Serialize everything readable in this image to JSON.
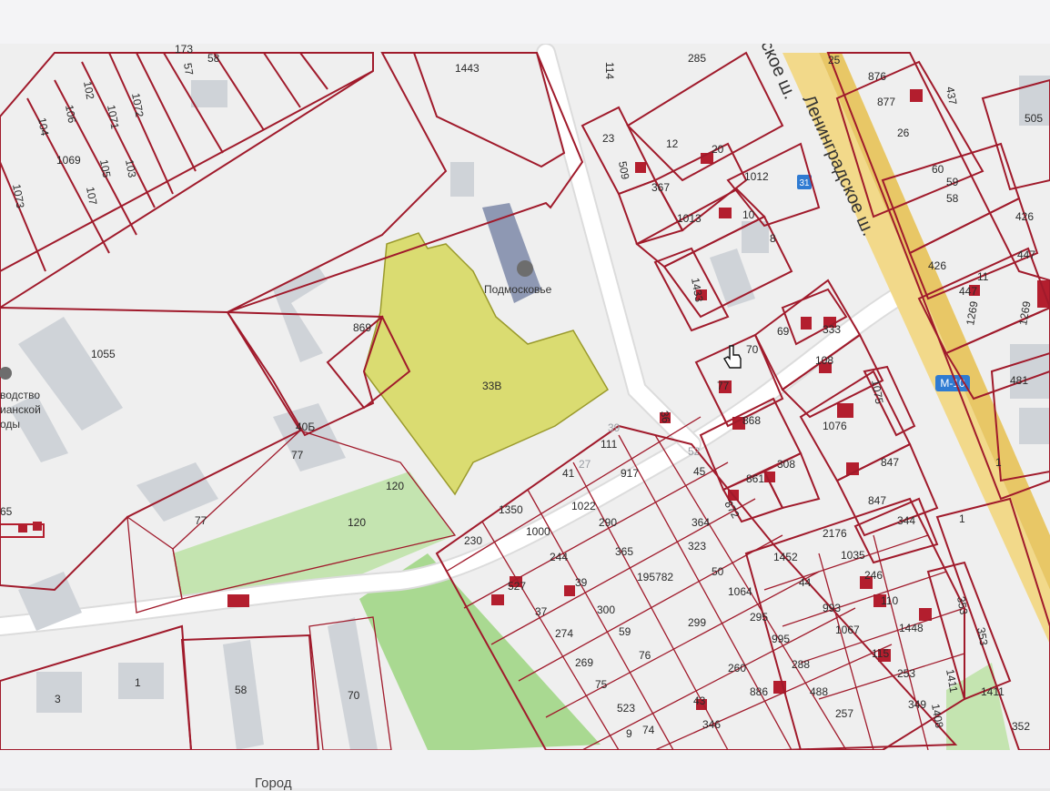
{
  "map": {
    "road_label": "M-10",
    "highway_sign": "31",
    "street_name_1": "Ленинградское ш.",
    "street_name_2": "ское ш.",
    "poi_name": "Подмосковье",
    "factory_label_1": "водство",
    "factory_label_2": "ианской",
    "factory_label_3": "оды",
    "highlighted_plot_id": "33В",
    "plot_ids_left": [
      "1443",
      "173",
      "58",
      "57",
      "102",
      "106",
      "1071",
      "1072",
      "104",
      "1069",
      "105",
      "103",
      "107",
      "1073",
      "1055",
      "869",
      "40Б",
      "77",
      "120",
      "77",
      "120",
      "65"
    ],
    "plot_ids_center": [
      "114",
      "285",
      "23",
      "12",
      "20",
      "509",
      "367",
      "1012",
      "1013",
      "10",
      "8",
      "1433",
      "69",
      "333",
      "70",
      "108",
      "77",
      "1075",
      "868",
      "1076",
      "36",
      "39",
      "111",
      "52",
      "45",
      "861",
      "308",
      "41",
      "27",
      "917",
      "872",
      "1350",
      "1022",
      "230",
      "1000",
      "290",
      "365",
      "364",
      "323",
      "244",
      "527",
      "39",
      "195782",
      "50",
      "37",
      "300",
      "1064",
      "299",
      "295",
      "274",
      "59",
      "269",
      "76",
      "995",
      "75",
      "260",
      "886",
      "288",
      "488",
      "523",
      "43",
      "9",
      "74",
      "346",
      "257"
    ],
    "plot_ids_right": [
      "25",
      "876",
      "877",
      "437",
      "505",
      "26",
      "60",
      "59",
      "58",
      "426",
      "447",
      "426",
      "447",
      "11",
      "1269",
      "1269",
      "481",
      "847",
      "847",
      "344",
      "1452",
      "2176",
      "1035",
      "246",
      "44",
      "993",
      "110",
      "1067",
      "1448",
      "115",
      "253",
      "353",
      "353",
      "1411",
      "1411",
      "349",
      "1408",
      "352",
      "1",
      "1"
    ],
    "bottom_labels": [
      "3",
      "1",
      "58",
      "70"
    ]
  },
  "footer": {
    "partial_text": "Город"
  },
  "colors": {
    "plot_border": "#a01a2b",
    "highlight_fill": "#d6d85a",
    "green_area": "#b9dfa4",
    "highway": "#e8c766"
  }
}
